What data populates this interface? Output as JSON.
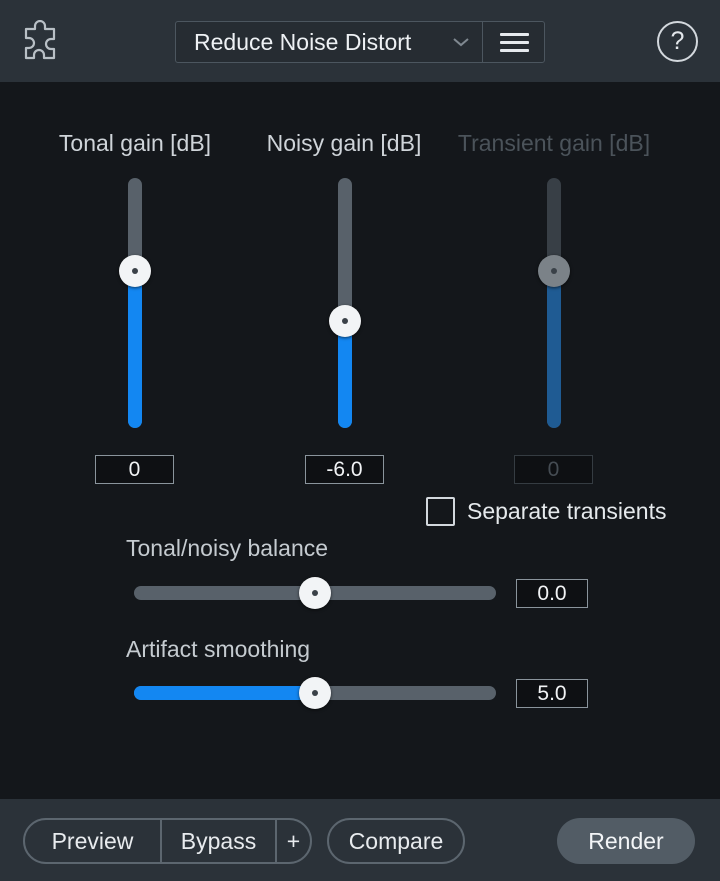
{
  "header": {
    "plugin_icon": "puzzle-piece-icon",
    "preset": "Reduce Noise Distort",
    "preset_chevron_icon": "chevron-down-icon",
    "menu_icon": "hamburger-menu-icon",
    "help_label": "?"
  },
  "gains": [
    {
      "label": "Tonal gain [dB]",
      "value": "0",
      "level": 0.63,
      "enabled": true
    },
    {
      "label": "Noisy gain [dB]",
      "value": "-6.0",
      "level": 0.43,
      "enabled": true
    },
    {
      "label": "Transient gain [dB]",
      "value": "0",
      "level": 0.63,
      "enabled": false
    }
  ],
  "separate_transients": {
    "label": "Separate transients",
    "checked": false
  },
  "balance": {
    "label": "Tonal/noisy balance",
    "value": "0.0",
    "level": 0.5,
    "filled": false
  },
  "smoothing": {
    "label": "Artifact smoothing",
    "value": "5.0",
    "level": 0.5,
    "filled": true
  },
  "footer": {
    "preview": "Preview",
    "bypass": "Bypass",
    "plus": "+",
    "compare": "Compare",
    "render": "Render"
  },
  "colors": {
    "accent": "#1387f2",
    "panel": "#2b3239",
    "background": "#14171b"
  }
}
